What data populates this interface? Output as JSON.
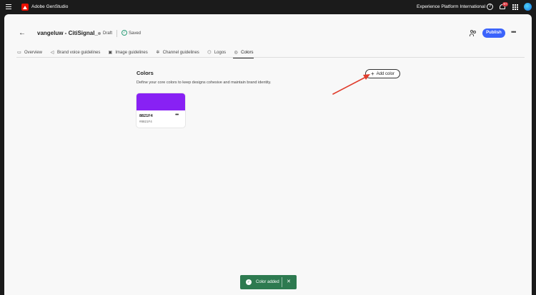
{
  "topbar": {
    "app_name": "Adobe GenStudio",
    "org_name": "Experience Platform International",
    "notification_count": "9+",
    "help_glyph": "?"
  },
  "header": {
    "title": "vangeluw - CitiSignal_",
    "status_draft": "Draft",
    "status_saved": "Saved",
    "publish_label": "Publish"
  },
  "tabs": [
    {
      "label": "Overview",
      "icon": "overview-icon"
    },
    {
      "label": "Brand voice guidelines",
      "icon": "megaphone-icon"
    },
    {
      "label": "Image guidelines",
      "icon": "image-icon"
    },
    {
      "label": "Channel guidelines",
      "icon": "channel-icon"
    },
    {
      "label": "Logos",
      "icon": "logo-icon"
    },
    {
      "label": "Colors",
      "icon": "palette-icon",
      "active": true
    }
  ],
  "colors_section": {
    "title": "Colors",
    "description": "Define your core colors to keep designs cohesive and maintain brand identity.",
    "add_label": "Add color"
  },
  "color_cards": [
    {
      "name": "8821F4",
      "hex": "#8821F4",
      "swatch": "#8821f4"
    }
  ],
  "toast": {
    "message": "Color added",
    "close": "✕"
  },
  "colors": {
    "accent": "#3b63fb",
    "toast_bg": "#2d7a50",
    "arrow": "#e03c2c"
  }
}
